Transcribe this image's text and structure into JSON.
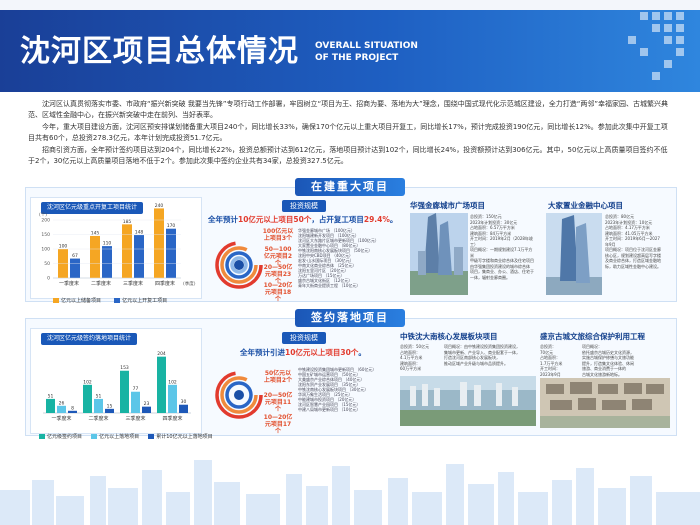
{
  "header": {
    "title": "沈河区项目总体情况",
    "subtitle_line1": "OVERALL SITUATION",
    "subtitle_line2": "OF THE PROJECT"
  },
  "intro": {
    "para1": "沈河区认真贯彻落实市委、市政府“振兴新突破 我要当先锋”专项行动工作部署，牢固树立“项目为王、招商为要、落地为大”理念，围绕中国式现代化示范城区建设，全力打造“两邻”幸福家园、古城繁兴典范、区域性金融中心，在振兴新突破中走在前列、当好表率。",
    "para2": "今年，重大项目建设方面，沈河区预安排谋划储备重大项目240个，同比增长33%，确保170个亿元以上重大项目开复工，同比增长17%，预计完成投资190亿元，同比增长12%。参加此次集中开复工项目共有60个，总投资278.3亿元，本年计划完成投资51.7亿元。",
    "para3": "招商引资方面，全年预计签约项目达到204个，同比增长22%，投资总额预计达到612亿元，落地项目预计达到102个，同比增长24%，投资额预计达到306亿元。其中，50亿元以上高质量项目签约不低于2个，30亿元以上高质量项目落地不低于2个。参加此次集中签约企业共有34家，总投资327.5亿元。"
  },
  "section1": {
    "title": "在建重大项目",
    "chart": {
      "title": "沈河区亿元级重点开复工项目统计",
      "legend": [
        "亿元以上储备项目",
        "亿元以上开复工项目"
      ],
      "tick_labels": [
        "一季度末",
        "二季度末",
        "三季度末",
        "四季度末"
      ],
      "x_axis_label": "(季度)",
      "y_axis_label": "(个)",
      "y_ticks": [
        "200",
        "150",
        "100",
        "50",
        "0"
      ]
    },
    "investment": {
      "tag": "投资规模",
      "headline_a": "全年预计",
      "headline_b": "10亿元以上项目50个",
      "headline_c": "，占开复工项目",
      "headline_d": "29.4%",
      "headline_e": "。",
      "tiers": [
        {
          "label": "100亿元以上项目3个"
        },
        {
          "label": "50—100亿元项目2个"
        },
        {
          "label": "20—50亿元项目23个"
        },
        {
          "label": "10—20亿元项目18个"
        }
      ],
      "project_lines": [
        "华强金廊城市广场 （100亿元）",
        "沈阳城建新开发项目 （100亿元）",
        "沈河区大东路片区城市更新项目 （100亿元）",
        "大家置业金融中心项目 （80亿元）",
        "中铁沈阳南核心发展板块项目 （50亿元）",
        "沈阳中央CBD项目 （40亿元）",
        "宏发·山水国际项目 （30亿元）",
        "中南文化商业综合体 （25亿元）",
        "沈阳五里河片区 （20亿元）",
        "万达广场项目 （15亿元）",
        "盛京古城文化街区 （12亿元）",
        "青年大街商业提质工程 （10亿元）"
      ]
    },
    "cards": [
      {
        "title": "华强金廊城市广场项目",
        "lines": [
          "总投资：150亿元",
          "2023年计划投资：30亿元",
          "占地面积：6.57万平方米",
          "建筑面积：84万平方米",
          "开工时间：2019年2月（2028年竣工）",
          "项目概况：一期规划建设7.1万平方米",
          "甲级写字楼和商业综合体及住宅项目",
          "由华强集团投资建设的城市综合体",
          "项目，集商业、办公、酒店、住宅于",
          "一体，辐射金廊商圈。"
        ]
      },
      {
        "title": "大家置业金融中心项目",
        "lines": [
          "总投资：80亿元",
          "2023年计划投资：10亿元",
          "占地面积：4.17万平方米",
          "建筑面积：41.05万平方米",
          "开工时间：2019年6月—2027",
          "年9月",
          "项目概况：项目位于沈河区金廊",
          "核心区，规划建设超高层写字楼",
          "及商业综合体，打造区域金融地",
          "标，助力区域性金融中心建设。"
        ]
      }
    ]
  },
  "section2": {
    "title": "签约落地项目",
    "chart": {
      "title": "沈河区亿元级签约落地项目统计",
      "legend": [
        "亿元级签约项目",
        "亿元以上落地项目",
        "累计10亿元以上落地项目"
      ],
      "tick_labels": [
        "一季度末",
        "二季度末",
        "三季度末",
        "四季度末"
      ]
    },
    "investment": {
      "tag": "投资规模",
      "headline_a": "全年预计引进",
      "headline_b": "10亿元以上项目30个",
      "headline_c": "。",
      "tiers": [
        {
          "label": "50亿元以上项目2个"
        },
        {
          "label": "20—50亿元项目11个"
        },
        {
          "label": "10—20亿元项目17个"
        }
      ],
      "project_lines": [
        "中铁建设投资集团城市更新项目 （60亿元）",
        "中国五矿城市运营项目 （50亿元）",
        "大美盛京产业综合体项目 （40亿元）",
        "沈阳东贸产业发展项目 （35亿元）",
        "中铁沈南核心发展板块项目 （30亿元）",
        "华润万象生活项目 （25亿元）",
        "中能建城市投资项目 （20亿元）",
        "沈河区智慧产业园项目 （15亿元）",
        "中建八局城市更新项目 （10亿元）"
      ]
    },
    "cards": [
      {
        "title": "中铁沈大南核心发展板块项目",
        "left_lines": [
          "总投资：50亿元",
          "占地面积：",
          "4.1万平方米",
          "建筑面积：",
          "60万平方米"
        ],
        "right_lines": [
          "项目概况：由中铁建设投资集团投资建设，",
          "集城市更新、产业导入、商业配套于一体，",
          "打造沈河区南部核心发展板块，",
          "推动区域产业升级与城市品质提升。"
        ]
      },
      {
        "title": "盛京古城文旅综合保护利用工程",
        "left_lines": [
          "总投资：",
          "70亿元",
          "占地面积：",
          "1.7万平方米",
          "开工时间：",
          "2023年9月"
        ],
        "right_lines": [
          "项目概况：",
          "依托盛京古城历史文化资源，",
          "实施古城保护修缮与文旅功能",
          "提升，打造集文化体验、休闲",
          "旅游、商业消费于一体的",
          "古城文化旅游新地标。"
        ]
      }
    ]
  },
  "chart_data": [
    {
      "type": "bar",
      "title": "沈河区亿元级重点开复工项目统计",
      "categories": [
        "一季度末",
        "二季度末",
        "三季度末",
        "四季度末"
      ],
      "xlabel": "(季度)",
      "ylabel": "(个)",
      "ylim": [
        0,
        200
      ],
      "series": [
        {
          "name": "亿元以上储备项目",
          "values": [
            100,
            145,
            185,
            240
          ],
          "color": "#f5a623"
        },
        {
          "name": "亿元以上开复工项目",
          "values": [
            67,
            110,
            148,
            170
          ],
          "color": "#2a66c6"
        }
      ]
    },
    {
      "type": "bar",
      "title": "沈河区亿元级签约落地项目统计",
      "categories": [
        "一季度末",
        "二季度末",
        "三季度末",
        "四季度末"
      ],
      "ylim": [
        0,
        210
      ],
      "series": [
        {
          "name": "亿元级签约项目",
          "values": [
            51,
            102,
            153,
            204
          ],
          "color": "#18b3a3"
        },
        {
          "name": "亿元以上落地项目",
          "values": [
            26,
            51,
            77,
            102
          ],
          "color": "#5cc6e8"
        },
        {
          "name": "累计10亿元以上落地项目",
          "values": [
            8,
            15,
            23,
            30
          ],
          "color": "#1d58b8"
        }
      ]
    }
  ]
}
